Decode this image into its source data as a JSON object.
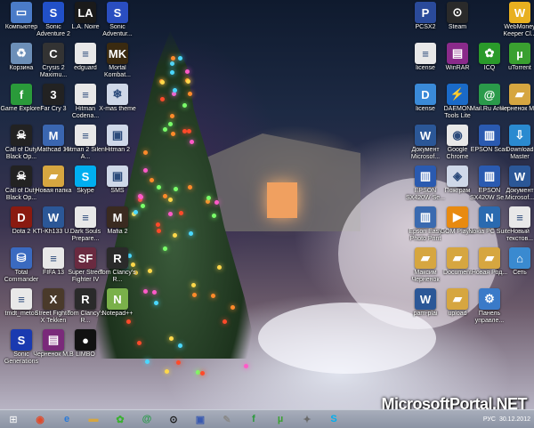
{
  "watermark": "MicrosoftPortal.NET",
  "desktop_icons_left": [
    {
      "label": "Компьютер",
      "icon": "computer-icon",
      "color": "#4a7bc8"
    },
    {
      "label": "Sonic Adventure 2",
      "icon": "sonic-icon",
      "color": "#2150c8"
    },
    {
      "label": "L.A. Noire",
      "icon": "la-noire-icon",
      "color": "#1a1a1a"
    },
    {
      "label": "Sonic Adventur...",
      "icon": "sonic-icon",
      "color": "#2a4ec0"
    },
    {
      "label": "Корзина",
      "icon": "recycle-bin-icon",
      "color": "#6c8fb8"
    },
    {
      "label": "Crysis 2 Maximu...",
      "icon": "crysis-icon",
      "color": "#333333"
    },
    {
      "label": "edguard",
      "icon": "document-icon",
      "color": "#e8e8e8"
    },
    {
      "label": "Mortal Kombat...",
      "icon": "mortal-kombat-icon",
      "color": "#3a2a10"
    },
    {
      "label": "Game Explorer",
      "icon": "game-explorer-icon",
      "color": "#2a9a3a"
    },
    {
      "label": "Far Cry 3",
      "icon": "farcry-icon",
      "color": "#222222"
    },
    {
      "label": "Hitman Codena...",
      "icon": "document-icon",
      "color": "#e8e8e8"
    },
    {
      "label": "X-mas theme",
      "icon": "xmas-theme-icon",
      "color": "#cfd8e8"
    },
    {
      "label": "Call of Duty Black Op...",
      "icon": "cod-icon",
      "color": "#222222"
    },
    {
      "label": "Mathcad 15",
      "icon": "mathcad-icon",
      "color": "#3a66b0"
    },
    {
      "label": "Hitman 2 Silent A...",
      "icon": "document-icon",
      "color": "#e8e8e8"
    },
    {
      "label": "Hitman 2",
      "icon": "window-icon",
      "color": "#cfd8e8"
    },
    {
      "label": "Call of Duty Black Op...",
      "icon": "cod-icon",
      "color": "#222222"
    },
    {
      "label": "Новая папка",
      "icon": "folder-icon",
      "color": "#d6a640"
    },
    {
      "label": "Skype",
      "icon": "skype-icon",
      "color": "#00aff0"
    },
    {
      "label": "SMS",
      "icon": "window-icon",
      "color": "#cfd8e8"
    },
    {
      "label": "Dota 2",
      "icon": "dota-icon",
      "color": "#8a1a10"
    },
    {
      "label": "KTI-Kh133 U...",
      "icon": "word-icon",
      "color": "#2b5797"
    },
    {
      "label": "Dark Souls Prepare...",
      "icon": "document-icon",
      "color": "#e8e8e8"
    },
    {
      "label": "Mafia 2",
      "icon": "mafia-icon",
      "color": "#3a2a20"
    },
    {
      "label": "Total Commander",
      "icon": "disk-icon",
      "color": "#3a6ac0"
    },
    {
      "label": "FIFA 13",
      "icon": "document-icon",
      "color": "#e8e8e8"
    },
    {
      "label": "Super Street Fighter IV",
      "icon": "street-fighter-icon",
      "color": "#6a2a40"
    },
    {
      "label": "Tom Clancy's R...",
      "icon": "rainbow-icon",
      "color": "#2a2a2a"
    },
    {
      "label": "tmdt_metod",
      "icon": "document-icon",
      "color": "#e8e8e8"
    },
    {
      "label": "Street Fighter X Tekken",
      "icon": "sf-tekken-icon",
      "color": "#4a3a2a"
    },
    {
      "label": "Tom Clancy's R...",
      "icon": "rainbow-icon",
      "color": "#2a2a2a"
    },
    {
      "label": "Notepad++",
      "icon": "notepad-icon",
      "color": "#7ab04a"
    },
    {
      "label": "Sonic Generations",
      "icon": "sonic-icon",
      "color": "#1a3ab0"
    },
    {
      "label": "Черненок М.В",
      "icon": "winrar-icon",
      "color": "#7a2a7a"
    },
    {
      "label": "LIMBO",
      "icon": "limbo-icon",
      "color": "#111111"
    }
  ],
  "desktop_icons_right": [
    {
      "label": "PCSX2",
      "icon": "pcsx2-icon",
      "color": "#2a4a9a"
    },
    {
      "label": "Steam",
      "icon": "steam-icon",
      "color": "#2a2a2a"
    },
    {
      "label": "WebMoney Keeper Cl...",
      "icon": "webmoney-icon",
      "color": "#e8b020"
    },
    {
      "label": "license",
      "icon": "document-icon",
      "color": "#e8e8e8"
    },
    {
      "label": "WinRAR",
      "icon": "winrar-icon",
      "color": "#8a2a8a"
    },
    {
      "label": "ICQ",
      "icon": "icq-icon",
      "color": "#2a9a2a"
    },
    {
      "label": "uTorrent",
      "icon": "utorrent-icon",
      "color": "#3aa030"
    },
    {
      "label": "license",
      "icon": "dat-icon",
      "color": "#3a8ad8"
    },
    {
      "label": "DAEMON Tools Lite",
      "icon": "daemon-tools-icon",
      "color": "#1a6ac8"
    },
    {
      "label": "Mail.Ru Агент",
      "icon": "mailru-icon",
      "color": "#2a9a4a"
    },
    {
      "label": "Черненок М.В",
      "icon": "folder-icon",
      "color": "#d6a640"
    },
    {
      "label": "Документ Microsof...",
      "icon": "word-icon",
      "color": "#2b5797"
    },
    {
      "label": "Google Chrome",
      "icon": "chrome-icon",
      "color": "#e8e8e8"
    },
    {
      "label": "EPSON Scan",
      "icon": "epson-scan-icon",
      "color": "#2a5ab0"
    },
    {
      "label": "Download Master",
      "icon": "download-master-icon",
      "color": "#2a8ad0"
    },
    {
      "label": "EPSON SX420W Se...",
      "icon": "epson-icon",
      "color": "#2a5ab0"
    },
    {
      "label": "Пожграм",
      "icon": "gamepad-icon",
      "color": "#cfd8e8"
    },
    {
      "label": "EPSON SX420W Se...",
      "icon": "epson-icon",
      "color": "#2a5ab0"
    },
    {
      "label": "Документ Microsof...",
      "icon": "word-icon",
      "color": "#2b5797"
    },
    {
      "label": "Epson Easy Photo Print",
      "icon": "epson-photo-icon",
      "color": "#3a6ab0"
    },
    {
      "label": "GOM Player",
      "icon": "gom-player-icon",
      "color": "#e88a10"
    },
    {
      "label": "Nokia PC Suite",
      "icon": "nokia-icon",
      "color": "#2a6ab0"
    },
    {
      "label": "Новый текстов...",
      "icon": "document-icon",
      "color": "#e8e8e8"
    },
    {
      "label": "Максим Черненок",
      "icon": "folder-icon",
      "color": "#d6a640"
    },
    {
      "label": "Document",
      "icon": "folder-icon",
      "color": "#d6a640"
    },
    {
      "label": "Новая Род...",
      "icon": "folder-icon",
      "color": "#d6a640"
    },
    {
      "label": "Сеть",
      "icon": "network-icon",
      "color": "#3a8ad0"
    },
    {
      "label": "pam-plai",
      "icon": "word-icon",
      "color": "#2b5797"
    },
    {
      "label": "upload",
      "icon": "folder-icon",
      "color": "#d6a640"
    },
    {
      "label": "Панель управле...",
      "icon": "control-panel-icon",
      "color": "#3a7ac8"
    }
  ],
  "taskbar": {
    "pinned": [
      {
        "name": "chrome-taskbar",
        "icon": "chrome-icon",
        "glyph": "◉",
        "color": "#e04a2a"
      },
      {
        "name": "ie-taskbar",
        "icon": "ie-icon",
        "glyph": "e",
        "color": "#2a7ad8"
      },
      {
        "name": "explorer-taskbar",
        "icon": "folder-icon",
        "glyph": "▬",
        "color": "#d6a640"
      },
      {
        "name": "icq-taskbar",
        "icon": "icq-icon",
        "glyph": "✿",
        "color": "#3ab030"
      },
      {
        "name": "mailru-taskbar",
        "icon": "mailru-icon",
        "glyph": "@",
        "color": "#2a9a4a"
      },
      {
        "name": "steam-taskbar",
        "icon": "steam-icon",
        "glyph": "⊙",
        "color": "#1a1a1a"
      },
      {
        "name": "save-taskbar",
        "icon": "floppy-icon",
        "glyph": "▣",
        "color": "#3a5ab0"
      },
      {
        "name": "tool-taskbar",
        "icon": "tool-icon",
        "glyph": "✎",
        "color": "#8a8a8a"
      },
      {
        "name": "game-explorer-taskbar",
        "icon": "game-explorer-icon",
        "glyph": "f",
        "color": "#2a9a3a"
      },
      {
        "name": "utorrent-taskbar",
        "icon": "utorrent-icon",
        "glyph": "µ",
        "color": "#3aa030"
      },
      {
        "name": "rainmeter-taskbar",
        "icon": "gear-icon",
        "glyph": "✦",
        "color": "#6a6a6a"
      },
      {
        "name": "skype-taskbar",
        "icon": "skype-icon",
        "glyph": "S",
        "color": "#00aff0"
      }
    ],
    "tray": {
      "language": "РУС",
      "date": "30.12.2012"
    }
  }
}
